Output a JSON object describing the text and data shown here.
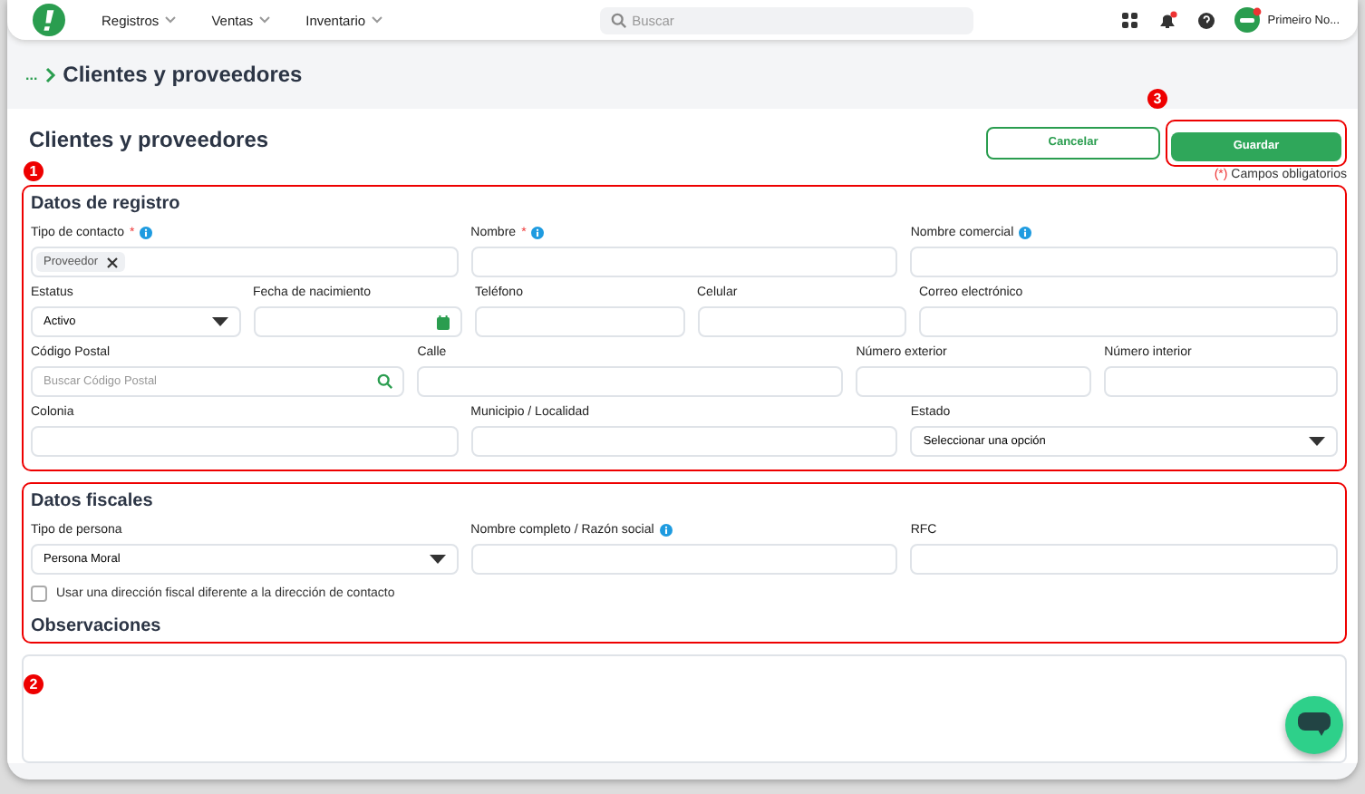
{
  "nav": {
    "menus": [
      {
        "label": "Registros"
      },
      {
        "label": "Ventas"
      },
      {
        "label": "Inventario"
      }
    ],
    "search_placeholder": "Buscar",
    "user": "Primeiro No..."
  },
  "breadcrumb": {
    "ellipsis": "...",
    "current": "Clientes y proveedores"
  },
  "header": {
    "title": "Clientes y proveedores",
    "cancel": "Cancelar",
    "save": "Guardar",
    "required_mark": "(*)",
    "required_note": "Campos obligatorios"
  },
  "sections": [
    {
      "title": "Datos de registro",
      "fields": [
        {
          "label": "Tipo de contacto",
          "required_mark": "*",
          "info": true,
          "kind": "tags",
          "tags": [
            "Proveedor"
          ]
        },
        {
          "label": "Nombre",
          "required_mark": "*",
          "info": true,
          "kind": "text"
        },
        {
          "label": "Nombre comercial",
          "info": true,
          "kind": "text"
        },
        {
          "label": "Estatus",
          "kind": "select",
          "value": "Activo"
        },
        {
          "label": "Fecha de nacimiento",
          "kind": "date"
        },
        {
          "label": "Teléfono",
          "kind": "text"
        },
        {
          "label": "Celular",
          "kind": "text"
        },
        {
          "label": "Correo electrónico",
          "kind": "text"
        },
        {
          "label": "Código Postal",
          "kind": "search",
          "placeholder": "Buscar Código Postal"
        },
        {
          "label": "Calle",
          "kind": "text"
        },
        {
          "label": "Número exterior",
          "kind": "text"
        },
        {
          "label": "Número interior",
          "kind": "text"
        },
        {
          "label": "Colonia",
          "kind": "text"
        },
        {
          "label": "Municipio / Localidad",
          "kind": "text"
        },
        {
          "label": "Estado",
          "kind": "select",
          "value": "Seleccionar una opción"
        }
      ]
    },
    {
      "title": "Datos fiscales",
      "fields": [
        {
          "label": "Tipo de persona",
          "kind": "select",
          "value": "Persona Moral"
        },
        {
          "label": "Nombre completo / Razón social",
          "info": true,
          "kind": "text"
        },
        {
          "label": "RFC",
          "kind": "text"
        }
      ],
      "checkbox": {
        "label": "Usar una dirección fiscal diferente a la dirección de contacto",
        "checked": false
      }
    }
  ],
  "observations": {
    "title": "Observaciones"
  },
  "markers": [
    {
      "label": "1"
    },
    {
      "label": "2"
    },
    {
      "label": "3"
    }
  ]
}
